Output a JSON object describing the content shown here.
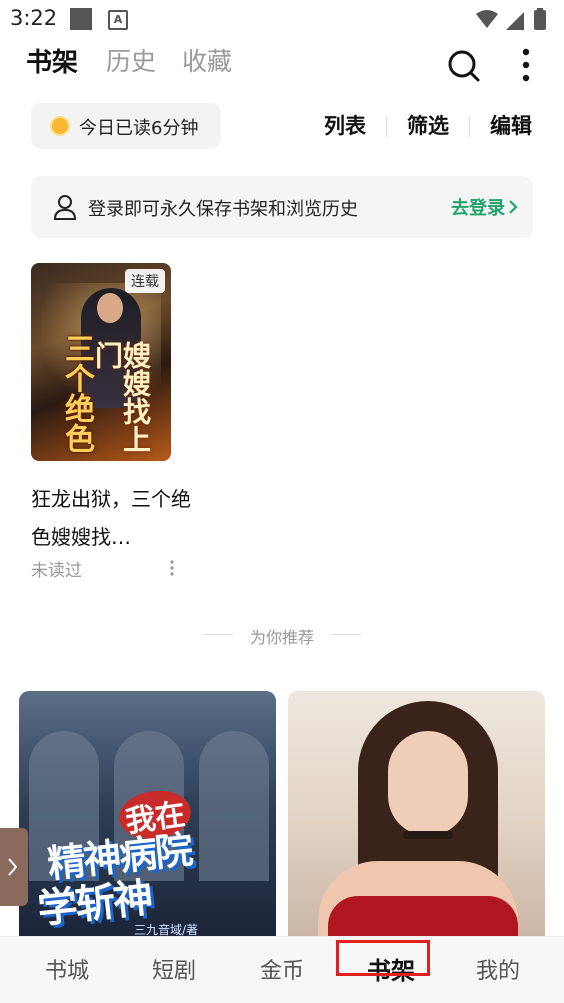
{
  "status_bar": {
    "time": "3:22",
    "notif_letter": "A"
  },
  "header": {
    "tabs": [
      {
        "label": "书架",
        "active": true
      },
      {
        "label": "历史",
        "active": false
      },
      {
        "label": "收藏",
        "active": false
      }
    ],
    "search_icon": "search-icon",
    "more_icon": "more-vertical-icon"
  },
  "toolbar": {
    "read_time": "今日已读6分钟",
    "actions": [
      "列表",
      "筛选",
      "编辑"
    ]
  },
  "login_banner": {
    "text": "登录即可永久保存书架和浏览历史",
    "link": "去登录"
  },
  "shelf": {
    "books": [
      {
        "badge": "连载",
        "title": "狂龙出狱，三个绝色嫂嫂找…",
        "status": "未读过",
        "cover_lettering": [
          "嫂嫂找上门",
          "三个绝色"
        ]
      }
    ]
  },
  "recommend": {
    "heading": "为你推荐",
    "cards": [
      {
        "cover_lettering": [
          "我在",
          "精神病院",
          "学斩神"
        ],
        "cover_author": "三九音域/著"
      },
      {
        "cover_lettering": []
      }
    ]
  },
  "bottom_nav": {
    "items": [
      {
        "label": "书城",
        "active": false
      },
      {
        "label": "短剧",
        "active": false
      },
      {
        "label": "金币",
        "active": false
      },
      {
        "label": "书架",
        "active": true
      },
      {
        "label": "我的",
        "active": false
      }
    ]
  },
  "colors": {
    "accent_green": "#1fa36a",
    "highlight_red": "#e02020"
  }
}
